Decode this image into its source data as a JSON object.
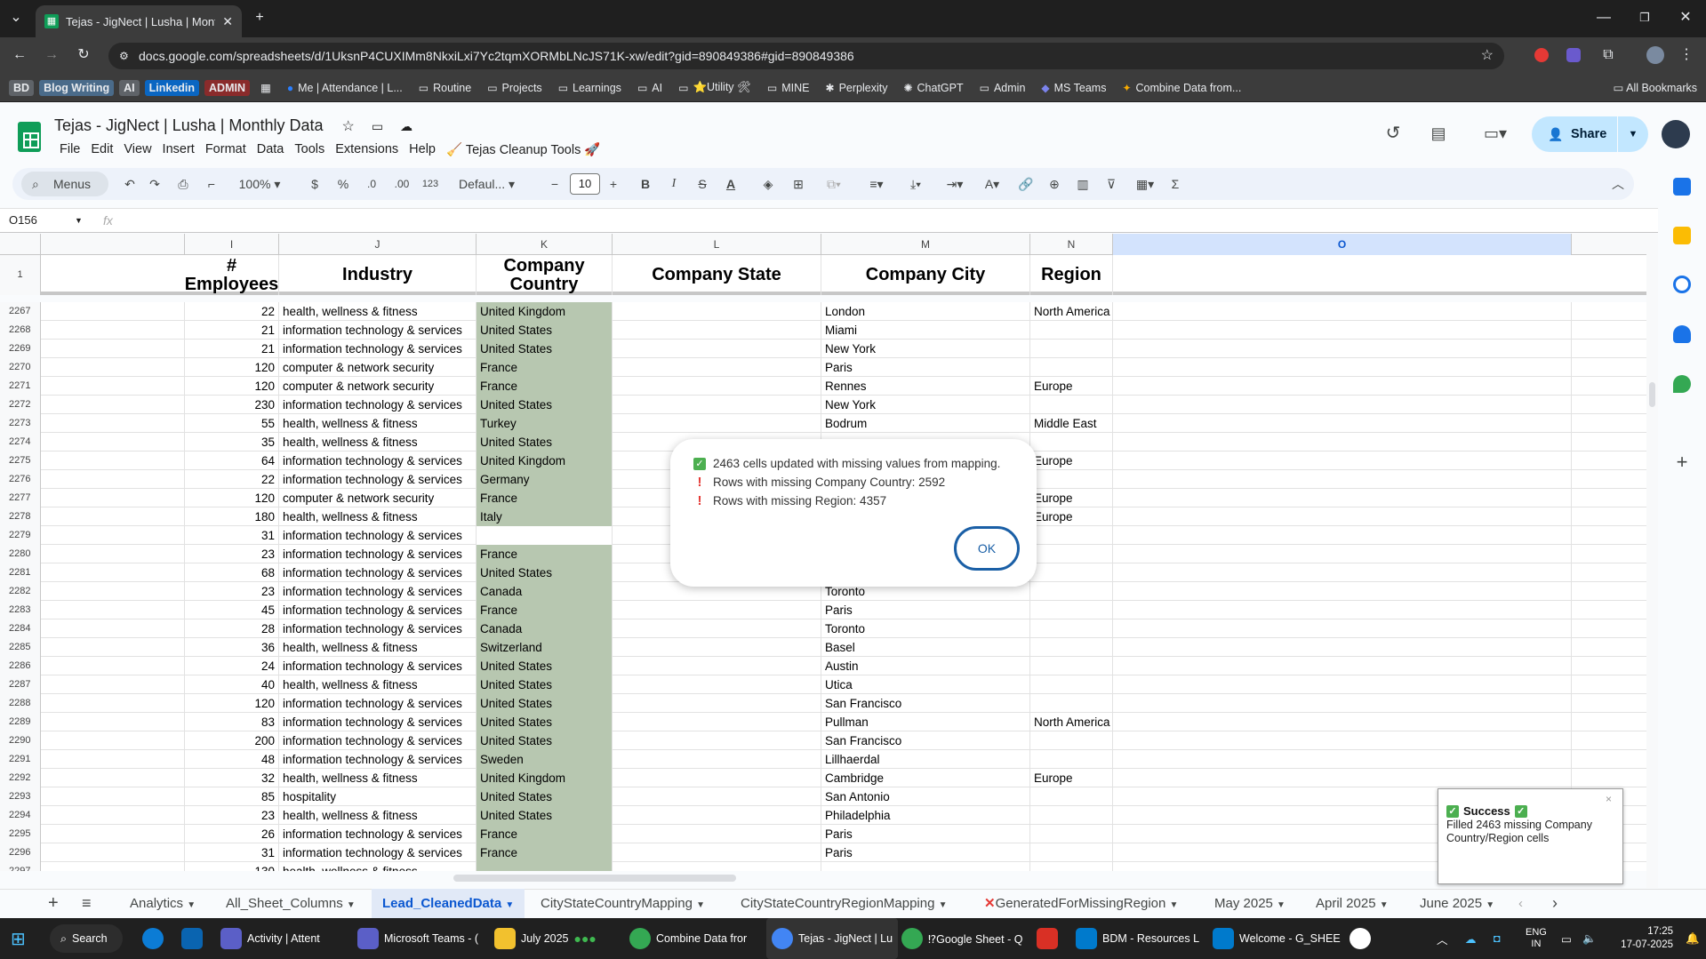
{
  "browser": {
    "tab_title": "Tejas - JigNect | Lusha | Monthly Data",
    "url": "docs.google.com/spreadsheets/d/1UksnP4CUXIMm8NkxiLxi7Yc2tqmXORMbLNcJS71K-xw/edit?gid=890849386#gid=890849386",
    "bookmarks": [
      "BD",
      "Blog Writing",
      "AI",
      "Linkedin",
      "ADMIN",
      "Me | Attendance | L...",
      "Routine",
      "Projects",
      "Learnings",
      "AI",
      "⭐Utility 🛠",
      "MINE",
      "Perplexity",
      "ChatGPT",
      "Admin",
      "MS Teams",
      "Combine Data from..."
    ],
    "all_bookmarks": "All Bookmarks"
  },
  "sheet": {
    "title": "Tejas - JigNect | Lusha | Monthly Data",
    "menu": [
      "File",
      "Edit",
      "View",
      "Insert",
      "Format",
      "Data",
      "Tools",
      "Extensions",
      "Help",
      "🧹 Tejas Cleanup Tools 🚀"
    ],
    "share": "Share",
    "toolbar": {
      "menus": "Menus",
      "zoom": "100%",
      "currency": "$",
      "percent": "%",
      "dec_less": ".0",
      "dec_more": ".00",
      "num_fmt": "123",
      "font": "Defaul...",
      "font_size": "10"
    },
    "name_box": "O156",
    "fx": "fx",
    "col_letters": [
      "I",
      "J",
      "K",
      "L",
      "M",
      "N",
      "O"
    ],
    "headers": {
      "employees": "# Employees",
      "industry": "Industry",
      "country": "Company Country",
      "state": "Company State",
      "city": "Company City",
      "region": "Region"
    },
    "header_row_num": "1",
    "rows": [
      {
        "n": "2267",
        "emp": "22",
        "ind": "health, wellness & fitness",
        "country": "United Kingdom",
        "city": "London",
        "region": "North America"
      },
      {
        "n": "2268",
        "emp": "21",
        "ind": "information technology & services",
        "country": "United States",
        "city": "Miami",
        "region": ""
      },
      {
        "n": "2269",
        "emp": "21",
        "ind": "information technology & services",
        "country": "United States",
        "city": "New York",
        "region": ""
      },
      {
        "n": "2270",
        "emp": "120",
        "ind": "computer & network security",
        "country": "France",
        "city": "Paris",
        "region": ""
      },
      {
        "n": "2271",
        "emp": "120",
        "ind": "computer & network security",
        "country": "France",
        "city": "Rennes",
        "region": "Europe"
      },
      {
        "n": "2272",
        "emp": "230",
        "ind": "information technology & services",
        "country": "United States",
        "city": "New York",
        "region": ""
      },
      {
        "n": "2273",
        "emp": "55",
        "ind": "health, wellness & fitness",
        "country": "Turkey",
        "city": "Bodrum",
        "region": "Middle East"
      },
      {
        "n": "2274",
        "emp": "35",
        "ind": "health, wellness & fitness",
        "country": "United States",
        "city": "",
        "region": ""
      },
      {
        "n": "2275",
        "emp": "64",
        "ind": "information technology & services",
        "country": "United Kingdom",
        "city": "",
        "region": "Europe"
      },
      {
        "n": "2276",
        "emp": "22",
        "ind": "information technology & services",
        "country": "Germany",
        "city": "",
        "region": ""
      },
      {
        "n": "2277",
        "emp": "120",
        "ind": "computer & network security",
        "country": "France",
        "city": "",
        "region": "Europe"
      },
      {
        "n": "2278",
        "emp": "180",
        "ind": "health, wellness & fitness",
        "country": "Italy",
        "city": "",
        "region": "Europe"
      },
      {
        "n": "2279",
        "emp": "31",
        "ind": "information technology & services",
        "country": "",
        "city": "",
        "region": ""
      },
      {
        "n": "2280",
        "emp": "23",
        "ind": "information technology & services",
        "country": "France",
        "city": "",
        "region": ""
      },
      {
        "n": "2281",
        "emp": "68",
        "ind": "information technology & services",
        "country": "United States",
        "city": "",
        "region": ""
      },
      {
        "n": "2282",
        "emp": "23",
        "ind": "information technology & services",
        "country": "Canada",
        "city": "Toronto",
        "region": ""
      },
      {
        "n": "2283",
        "emp": "45",
        "ind": "information technology & services",
        "country": "France",
        "city": "Paris",
        "region": ""
      },
      {
        "n": "2284",
        "emp": "28",
        "ind": "information technology & services",
        "country": "Canada",
        "city": "Toronto",
        "region": ""
      },
      {
        "n": "2285",
        "emp": "36",
        "ind": "health, wellness & fitness",
        "country": "Switzerland",
        "city": "Basel",
        "region": ""
      },
      {
        "n": "2286",
        "emp": "24",
        "ind": "information technology & services",
        "country": "United States",
        "city": "Austin",
        "region": ""
      },
      {
        "n": "2287",
        "emp": "40",
        "ind": "health, wellness & fitness",
        "country": "United States",
        "city": "Utica",
        "region": ""
      },
      {
        "n": "2288",
        "emp": "120",
        "ind": "information technology & services",
        "country": "United States",
        "city": "San Francisco",
        "region": ""
      },
      {
        "n": "2289",
        "emp": "83",
        "ind": "information technology & services",
        "country": "United States",
        "city": "Pullman",
        "region": "North America"
      },
      {
        "n": "2290",
        "emp": "200",
        "ind": "information technology & services",
        "country": "United States",
        "city": "San Francisco",
        "region": ""
      },
      {
        "n": "2291",
        "emp": "48",
        "ind": "information technology & services",
        "country": "Sweden",
        "city": "Lillhaerdal",
        "region": ""
      },
      {
        "n": "2292",
        "emp": "32",
        "ind": "health, wellness & fitness",
        "country": "United Kingdom",
        "city": "Cambridge",
        "region": "Europe"
      },
      {
        "n": "2293",
        "emp": "85",
        "ind": "hospitality",
        "country": "United States",
        "city": "San Antonio",
        "region": ""
      },
      {
        "n": "2294",
        "emp": "23",
        "ind": "health, wellness & fitness",
        "country": "United States",
        "city": "Philadelphia",
        "region": ""
      },
      {
        "n": "2295",
        "emp": "26",
        "ind": "information technology & services",
        "country": "France",
        "city": "Paris",
        "region": ""
      },
      {
        "n": "2296",
        "emp": "31",
        "ind": "information technology & services",
        "country": "France",
        "city": "Paris",
        "region": ""
      },
      {
        "n": "2297",
        "emp": "130",
        "ind": "health, wellness & fitness",
        "country": "",
        "city": "",
        "region": ""
      }
    ],
    "tabs": [
      "Analytics",
      "All_Sheet_Columns",
      "Lead_CleanedData",
      "CityStateCountryMapping",
      "CityStateCountryRegionMapping",
      "GeneratedForMissingRegion",
      "May 2025",
      "April 2025",
      "June 2025"
    ]
  },
  "dialog": {
    "line1": "2463 cells updated with missing values from mapping.",
    "line2": "Rows with missing Company Country: 2592",
    "line3": "Rows with missing Region: 4357",
    "ok": "OK"
  },
  "toast": {
    "title": "Success",
    "message": "Filled 2463 missing Company Country/Region cells",
    "close": "×"
  },
  "taskbar": {
    "search": "Search",
    "apps": [
      "Activity | Attent",
      "Microsoft Teams - (",
      "July 2025",
      "Combine Data fror",
      "Tejas - JigNect | Lu",
      "⁉Google Sheet - Q",
      "BDM - Resources L",
      "Welcome - G_SHEE"
    ],
    "lang1": "ENG",
    "lang2": "IN",
    "time": "17:25",
    "date": "17-07-2025"
  },
  "colors": {
    "accent": "#0b57d0",
    "country_fill": "#b7c7b0",
    "share_bg": "#c2e7ff"
  }
}
